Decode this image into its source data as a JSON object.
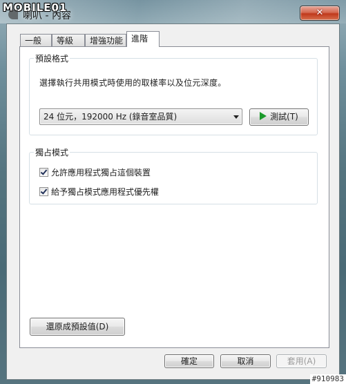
{
  "watermark": "MOBILE01",
  "window": {
    "title": "喇叭 - 內容",
    "close_label": "✕"
  },
  "tabs": [
    {
      "label": "一般",
      "active": false
    },
    {
      "label": "等級",
      "active": false
    },
    {
      "label": "增強功能",
      "active": false
    },
    {
      "label": "進階",
      "active": true
    }
  ],
  "default_format": {
    "legend": "預設格式",
    "description": "選擇執行共用模式時使用的取樣率以及位元深度。",
    "selected_value": "24 位元，192000 Hz (錄音室品質)",
    "test_button": "測試(T)"
  },
  "exclusive_mode": {
    "legend": "獨占模式",
    "options": [
      {
        "label": "允許應用程式獨占這個裝置",
        "checked": true
      },
      {
        "label": "給予獨占模式應用程式優先權",
        "checked": true
      }
    ]
  },
  "restore_defaults_button": "還原成預設值(D)",
  "dialog_buttons": {
    "ok": "確定",
    "cancel": "取消",
    "apply": "套用(A)",
    "apply_enabled": false
  },
  "image_tag": "#910983"
}
